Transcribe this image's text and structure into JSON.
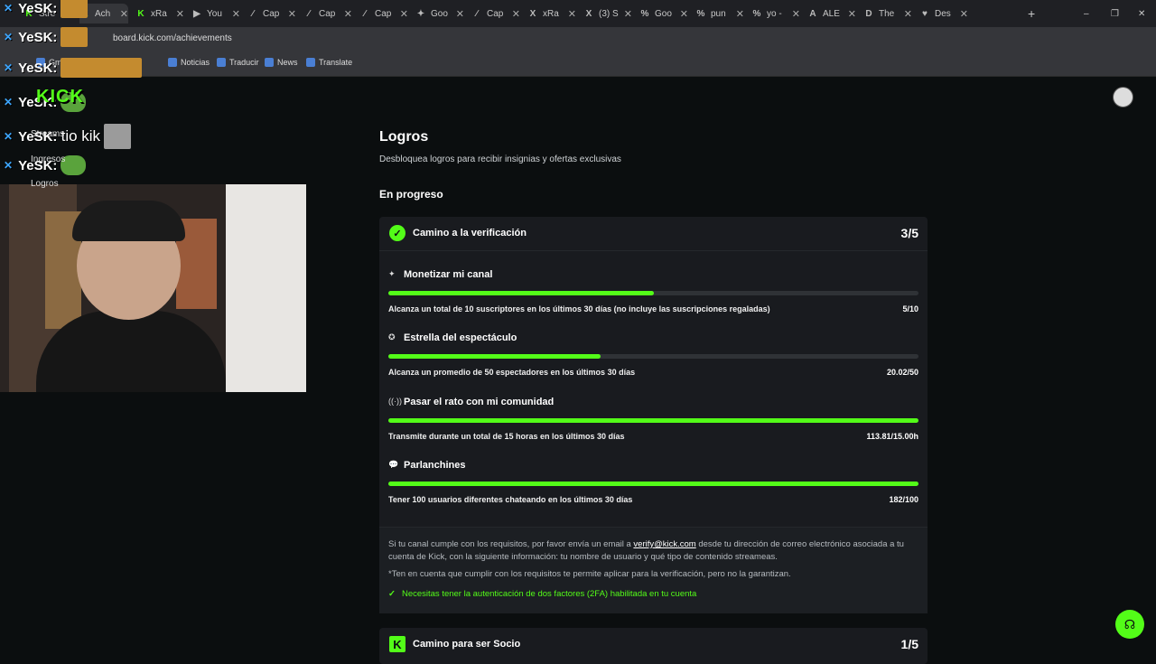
{
  "browser": {
    "tabs": [
      {
        "label": "Stre",
        "icon": "K"
      },
      {
        "label": "Ach",
        "icon": "K",
        "active": true
      },
      {
        "label": "xRa",
        "icon": "K"
      },
      {
        "label": "You",
        "icon": "▶"
      },
      {
        "label": "Cap",
        "icon": "∕"
      },
      {
        "label": "Cap",
        "icon": "∕"
      },
      {
        "label": "Cap",
        "icon": "∕"
      },
      {
        "label": "Goo",
        "icon": "✦"
      },
      {
        "label": "Cap",
        "icon": "∕"
      },
      {
        "label": "xRa",
        "icon": "X"
      },
      {
        "label": "(3) S",
        "icon": "X"
      },
      {
        "label": "Goo",
        "icon": "%"
      },
      {
        "label": "pun",
        "icon": "%"
      },
      {
        "label": "yo -",
        "icon": "%"
      },
      {
        "label": "ALE",
        "icon": "A"
      },
      {
        "label": "The",
        "icon": "D"
      },
      {
        "label": "Des",
        "icon": "♥"
      }
    ],
    "url": "board.kick.com/achievements",
    "bookmarks": [
      "Gmail",
      "Noticias",
      "Traducir",
      "News",
      "Translate"
    ]
  },
  "overlay": {
    "chat": [
      {
        "user": "YeSK:",
        "text": ""
      },
      {
        "user": "YeSK:",
        "text": ""
      },
      {
        "user": "YeSK:",
        "text": ""
      },
      {
        "user": "YeSK:",
        "text": ""
      },
      {
        "user": "YeSK:",
        "text": "tio kik"
      },
      {
        "user": "YeSK:",
        "text": ""
      }
    ],
    "kick_logo": "KICK",
    "sidebar": [
      "Streams",
      "Ingresos",
      "Logros"
    ]
  },
  "page": {
    "title": "Logros",
    "subtitle": "Desbloquea logros para recibir insignias y ofertas exclusivas",
    "section": "En progreso",
    "card": {
      "title": "Camino a la verificación",
      "progress": "3/5",
      "achievements": [
        {
          "icon": "✦",
          "title": "Monetizar mi canal",
          "desc": "Alcanza un total de 10 suscriptores en los últimos 30 días (no incluye las suscripciones regaladas)",
          "value": "5/10",
          "fraction": 0.5
        },
        {
          "icon": "✪",
          "title": "Estrella del espectáculo",
          "desc": "Alcanza un promedio de 50 espectadores en los últimos 30 días",
          "value": "20.02/50",
          "fraction": 0.4
        },
        {
          "icon": "((·))",
          "title": "Pasar el rato con mi comunidad",
          "desc": "Transmite durante un total de 15 horas en los últimos 30 días",
          "value": "113.81/15.00h",
          "fraction": 1.0
        },
        {
          "icon": "💬",
          "title": "Parlanchines",
          "desc": "Tener 100 usuarios diferentes chateando en los últimos 30 días",
          "value": "182/100",
          "fraction": 1.0
        }
      ],
      "note_prefix": "Si tu canal cumple con los requisitos, por favor envía un email a",
      "note_email": "verify@kick.com",
      "note_suffix": "desde tu dirección de correo electrónico asociada a tu cuenta de Kick, con la siguiente información: tu nombre de usuario y qué tipo de contenido streameas.",
      "note_disclaimer": "*Ten en cuenta que cumplir con los requisitos te permite aplicar para la verificación, pero no la garantizan.",
      "twofa": "Necesitas tener la autenticación de dos factores (2FA) habilitada en tu cuenta"
    },
    "card2": {
      "title": "Camino para ser Socio",
      "progress": "1/5"
    }
  },
  "colors": {
    "accent": "#53fc18",
    "bg": "#0b0e0f",
    "card": "#191b1f"
  }
}
